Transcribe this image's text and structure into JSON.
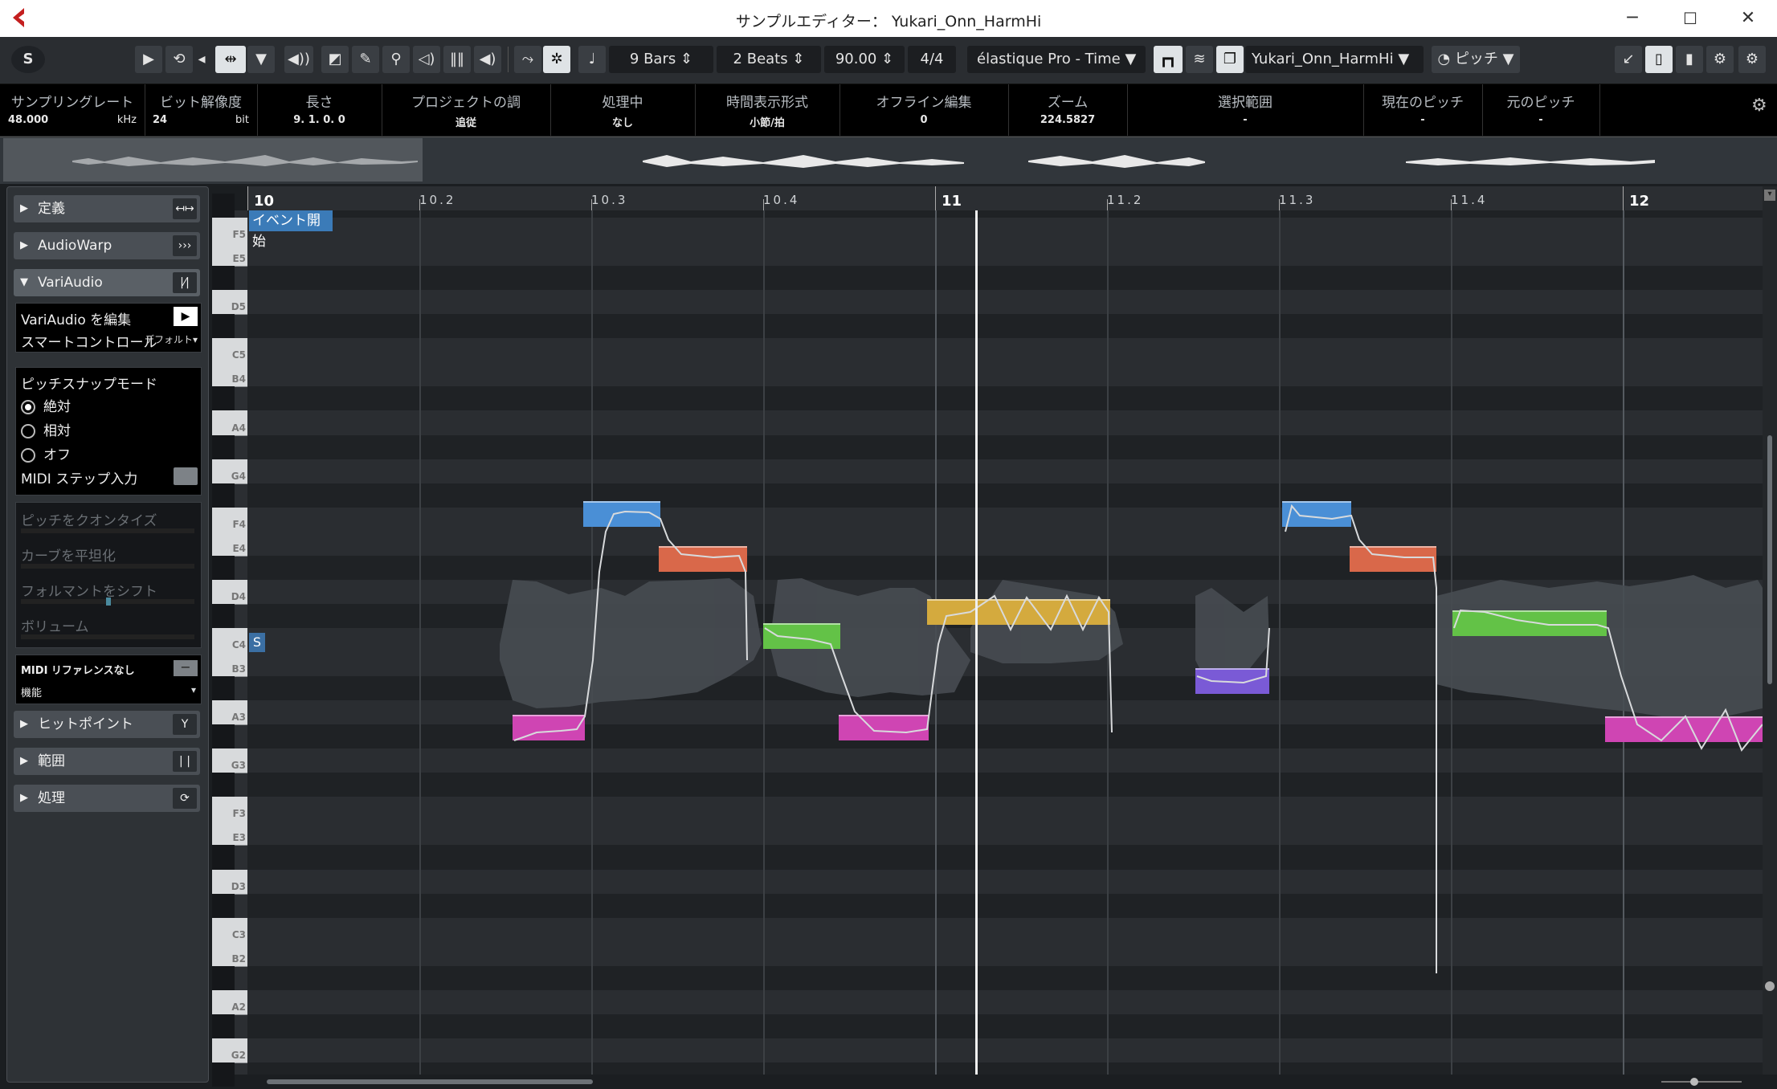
{
  "window": {
    "title": "サンプルエディター： Yukari_Onn_HarmHi",
    "minimize": "─",
    "maximize": "☐",
    "close": "✕"
  },
  "toolbar": {
    "solo": "S",
    "play": "▶",
    "loop": "⟲",
    "arrow": "◂",
    "range_select": "⇹",
    "dropdown": "▼",
    "bars": "9 Bars",
    "beats": "2 Beats",
    "tempo": "90.00",
    "signature": "4/4",
    "algorithm": "élastique Pro - Time",
    "event_name": "Yukari_Onn_HarmHi",
    "pitch_mode": "ピッチ",
    "updown": "⇕"
  },
  "infoline": [
    {
      "label": "サンプリングレート",
      "value": "48.000",
      "unit": "kHz"
    },
    {
      "label": "ビット解像度",
      "value": "24",
      "unit": "bit"
    },
    {
      "label": "長さ",
      "value": "9. 1. 0. 0"
    },
    {
      "label": "プロジェクトの調",
      "value": "追従"
    },
    {
      "label": "処理中",
      "value": "なし"
    },
    {
      "label": "時間表示形式",
      "value": "小節/拍"
    },
    {
      "label": "オフライン編集",
      "value": "0"
    },
    {
      "label": "ズーム",
      "value": "224.5827"
    },
    {
      "label": "選択範囲",
      "value": "-"
    },
    {
      "label": "現在のピッチ",
      "value": "-"
    },
    {
      "label": "元のピッチ",
      "value": "-"
    }
  ],
  "inspector": {
    "definition": "定義",
    "audiowarp": "AudioWarp",
    "variaudio": "VariAudio",
    "edit_variaudio": "VariAudio を編集",
    "smart_control": "スマートコントロール",
    "smart_control_value": "デフォルト",
    "pitch_snap_mode": "ピッチスナップモード",
    "snap_options": [
      "絶対",
      "相対",
      "オフ"
    ],
    "snap_selected": "絶対",
    "midi_step": "MIDI ステップ入力",
    "quantize_pitch": "ピッチをクオンタイズ",
    "straighten_curve": "カーブを平坦化",
    "formant_shift": "フォルマントをシフト",
    "volume": "ボリューム",
    "midi_reference": "MIDI リファレンスなし",
    "function": "機能",
    "hitpoints": "ヒットポイント",
    "range": "範囲",
    "process": "処理"
  },
  "ruler": {
    "labels": [
      "10",
      "10.2",
      "10.3",
      "10.4",
      "11",
      "11.2",
      "11.3",
      "11.4",
      "12"
    ]
  },
  "keys": [
    "F5",
    "E5",
    "D5",
    "C5",
    "B4",
    "A4",
    "G4",
    "F4",
    "E4",
    "D4",
    "C4",
    "B3",
    "A3",
    "G3",
    "F3",
    "E3",
    "D3",
    "C3",
    "B2",
    "A2",
    "G2"
  ],
  "editor": {
    "event_start": "イベント開始",
    "segment_marker": "S"
  },
  "colors": {
    "blue": "#4a8fd6",
    "orange": "#d9684a",
    "green": "#63c247",
    "magenta": "#cf45b3",
    "yellow": "#d4aa3e",
    "purple": "#7a5ad6"
  }
}
